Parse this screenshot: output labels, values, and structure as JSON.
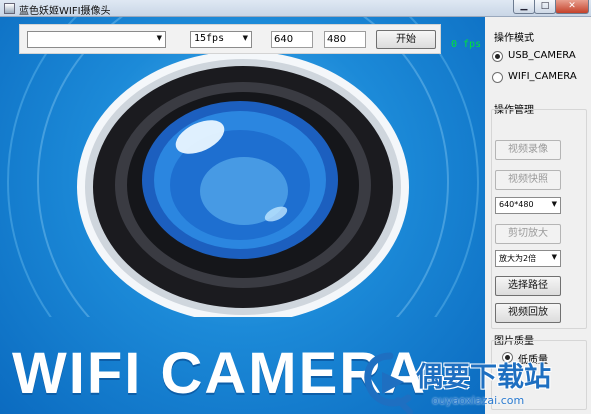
{
  "window": {
    "title": "蓝色妖姬WIFI摄像头",
    "min_icon": "minimize-icon",
    "max_icon": "maximize-icon",
    "close_icon": "close-icon"
  },
  "video": {
    "fps_readout": "0 fps",
    "banner_text": "WIFI CAMERA",
    "toolbar": {
      "source_value": "",
      "fps_value": "15fps",
      "width_value": "640",
      "height_value": "480",
      "start_label": "开始"
    }
  },
  "panel": {
    "mode_title": "操作模式",
    "modes": [
      {
        "label": "USB_CAMERA",
        "checked": true
      },
      {
        "label": "WIFI_CAMERA",
        "checked": false
      }
    ],
    "manage_title": "操作管理",
    "record_label": "视频录像",
    "snapshot_label": "视频快照",
    "resolution_value": "640*480",
    "crop_label": "剪切放大",
    "zoom_value": "放大为2倍",
    "choose_path_label": "选择路径",
    "playback_label": "视频回放",
    "quality_title": "图片质量",
    "quality_low_label": "低质量",
    "quality_low_checked": true
  },
  "watermark": {
    "name": "偶要下载站",
    "url": "ouyaoxiazai.com"
  },
  "colors": {
    "accent_blue": "#1c8ad8",
    "fps_green": "#00e43a",
    "close_red": "#c4412a"
  }
}
